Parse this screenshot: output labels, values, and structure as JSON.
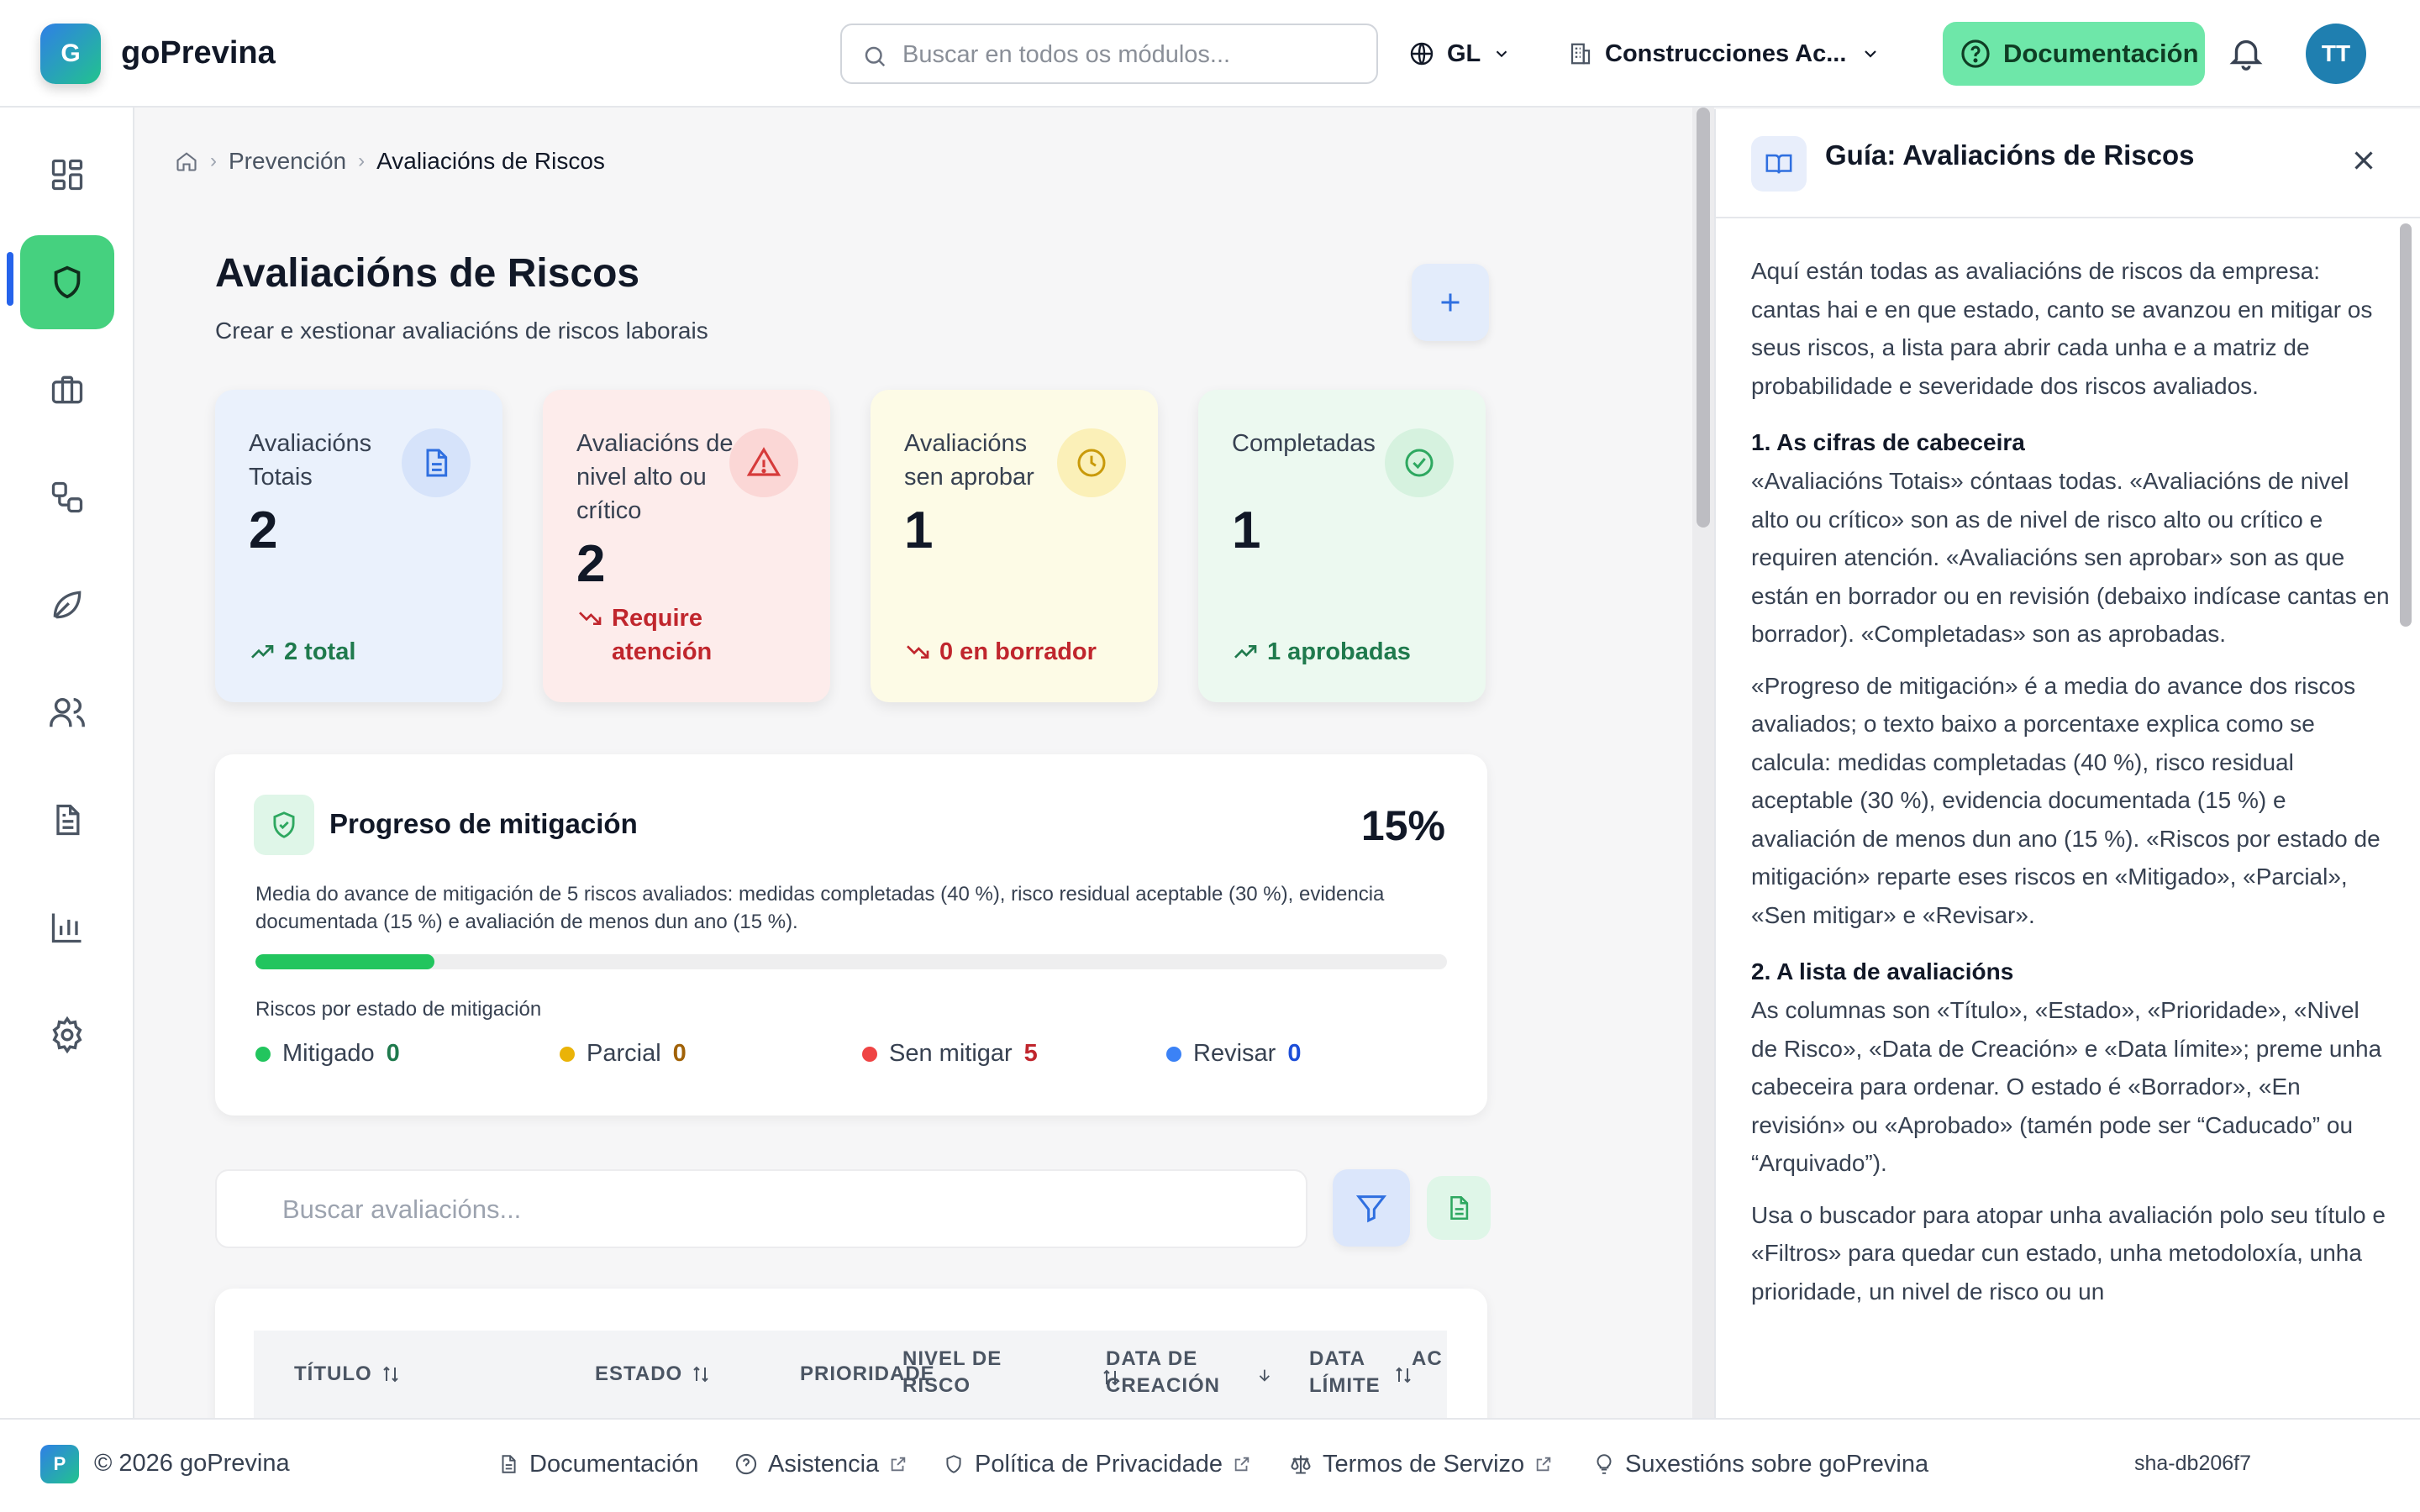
{
  "header": {
    "logo_letter": "G",
    "app_name": "goPrevina",
    "search_placeholder": "Buscar en todos os módulos...",
    "language": "GL",
    "company": "Construcciones Ac...",
    "doc_button": "Documentación",
    "avatar_initials": "TT"
  },
  "sidebar": {
    "items": [
      {
        "name": "dashboard",
        "icon": "grid-icon"
      },
      {
        "name": "prevention",
        "icon": "shield-icon",
        "active": true
      },
      {
        "name": "business",
        "icon": "briefcase-icon"
      },
      {
        "name": "workflow",
        "icon": "workflow-icon"
      },
      {
        "name": "environment",
        "icon": "leaf-icon"
      },
      {
        "name": "users",
        "icon": "users-icon"
      },
      {
        "name": "documents",
        "icon": "file-icon"
      },
      {
        "name": "reports",
        "icon": "bar-chart-icon"
      },
      {
        "name": "settings",
        "icon": "gear-icon"
      }
    ]
  },
  "breadcrumb": {
    "items": [
      "Prevención",
      "Avaliacións de Riscos"
    ]
  },
  "page": {
    "title": "Avaliacións de Riscos",
    "subtitle": "Crear e xestionar avaliacións de riscos laborais",
    "add_button": "+"
  },
  "stats": [
    {
      "label": "Avaliacións Totais",
      "value": "2",
      "trend": "2 total",
      "color": "#1f7a4d",
      "bg": "#eaf1fc",
      "icon_bg": "#d6e3fa",
      "icon_color": "#2f6fe0"
    },
    {
      "label": "Avaliacións de nivel alto ou crítico",
      "value": "2",
      "trend": "Require atención",
      "color": "#c0262d",
      "bg": "#fdeceb",
      "icon_bg": "#fbd7d6",
      "icon_color": "#d63b3b"
    },
    {
      "label": "Avaliacións sen aprobar",
      "value": "1",
      "trend": "0 en borrador",
      "color": "#c0262d",
      "bg": "#fdfbe6",
      "icon_bg": "#fbf0b8",
      "icon_color": "#c99a0a"
    },
    {
      "label": "Completadas",
      "value": "1",
      "trend": "1 aprobadas",
      "color": "#1f7a4d",
      "bg": "#ecf9f0",
      "icon_bg": "#d6f2df",
      "icon_color": "#2ea860"
    }
  ],
  "mitigation": {
    "title": "Progreso de mitigación",
    "percent_label": "15%",
    "percent": 15,
    "description": "Media do avance de mitigación de 5 riscos avaliados: medidas completadas (40 %), risco residual aceptable (30 %), evidencia documentada (15 %) e avaliación de menos dun ano (15 %).",
    "subtitle": "Riscos por estado de mitigación",
    "legend": [
      {
        "label": "Mitigado",
        "count": "0",
        "color": "#22c55e",
        "count_color": "#1f7a4d"
      },
      {
        "label": "Parcial",
        "count": "0",
        "color": "#eab308",
        "count_color": "#a16207"
      },
      {
        "label": "Sen mitigar",
        "count": "5",
        "color": "#ef4444",
        "count_color": "#c0262d"
      },
      {
        "label": "Revisar",
        "count": "0",
        "color": "#3b82f6",
        "count_color": "#1d4ed8"
      }
    ]
  },
  "list": {
    "search_placeholder": "Buscar avaliacións...",
    "columns": [
      "TÍTULO",
      "ESTADO",
      "PRIORIDADE",
      "NIVEL DE RISCO",
      "DATA DE CREACIÓN",
      "DATA LÍMITE",
      "AC"
    ]
  },
  "guide": {
    "title": "Guía: Avaliacións de Riscos",
    "intro": "Aquí están todas as avaliacións de riscos da empresa: cantas hai e en que estado, canto se avanzou en mitigar os seus riscos, a lista para abrir cada unha e a matriz de probabilidade e severidade dos riscos avaliados.",
    "s1_title": "1. As cifras de cabeceira",
    "s1_p1": "«Avaliacións Totais» cóntaas todas. «Avaliacións de nivel alto ou crítico» son as de nivel de risco alto ou crítico e requiren atención. «Avaliacións sen aprobar» son as que están en borrador ou en revisión (debaixo indícase cantas en borrador). «Completadas» son as aprobadas.",
    "s1_p2": "«Progreso de mitigación» é a media do avance dos riscos avaliados; o texto baixo a porcentaxe explica como se calcula: medidas completadas (40 %), risco residual aceptable (30 %), evidencia documentada (15 %) e avaliación de menos dun ano (15 %). «Riscos por estado de mitigación» reparte eses riscos en «Mitigado», «Parcial», «Sen mitigar» e «Revisar».",
    "s2_title": "2. A lista de avaliacións",
    "s2_p1": "As columnas son «Título», «Estado», «Prioridade», «Nivel de Risco», «Data de Creación» e «Data límite»; preme unha cabeceira para ordenar. O estado é «Borrador», «En revisión» ou «Aprobado» (tamén pode ser “Caducado” ou “Arquivado”).",
    "s2_p2": "Usa o buscador para atopar unha avaliación polo seu título e «Filtros» para quedar cun estado, unha metodoloxía, unha prioridade, un nivel de risco ou un"
  },
  "footer": {
    "badge": "P",
    "copyright": "© 2026 goPrevina",
    "links": [
      "Documentación",
      "Asistencia",
      "Política de Privacidade",
      "Termos de Servizo",
      "Suxestións sobre goPrevina"
    ],
    "sha": "sha-db206f7"
  }
}
